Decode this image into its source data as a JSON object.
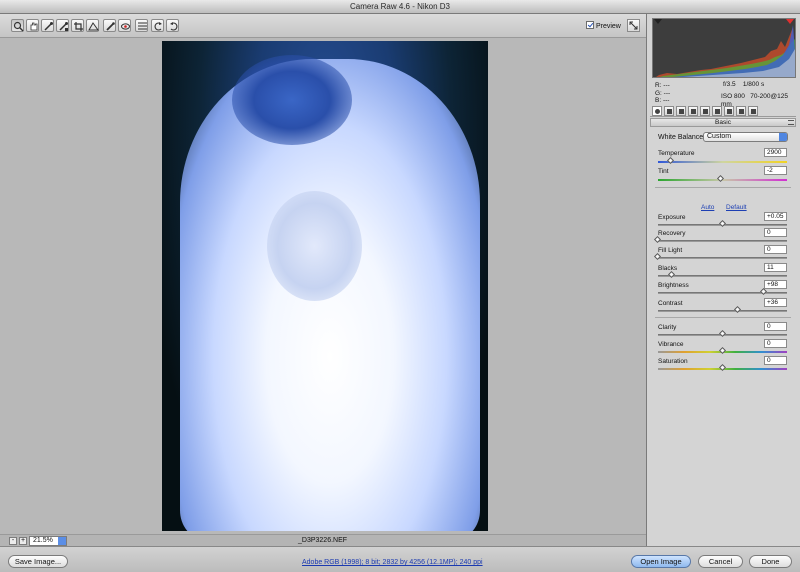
{
  "window": {
    "title": "Camera Raw 4.6  -  Nikon D3"
  },
  "toolbar": {
    "tools": [
      {
        "name": "zoom-tool"
      },
      {
        "name": "hand-tool"
      },
      {
        "name": "white-balance-tool"
      },
      {
        "name": "color-sampler-tool"
      },
      {
        "name": "crop-tool"
      },
      {
        "name": "straighten-tool"
      },
      {
        "name": "retouch-tool"
      },
      {
        "name": "red-eye-tool"
      },
      {
        "name": "preferences-tool"
      },
      {
        "name": "rotate-left-tool"
      },
      {
        "name": "rotate-right-tool"
      }
    ],
    "preview_label": "Preview",
    "preview_checked": true
  },
  "status": {
    "zoom": "21.5%",
    "filename": "_D3P3226.NEF"
  },
  "footer": {
    "save_label": "Save Image...",
    "workflow_link": "Adobe RGB (1998); 8 bit; 2832 by 4256 (12.1MP); 240 ppi",
    "open_label": "Open Image",
    "cancel_label": "Cancel",
    "done_label": "Done"
  },
  "info": {
    "r": "R:   ---",
    "g": "G:   ---",
    "b": "B:   ---",
    "aperture": "f/3.5",
    "shutter": "1/800 s",
    "iso": "ISO 800",
    "lens": "70-200@125 mm"
  },
  "panel": {
    "section_title": "Basic",
    "white_balance_label": "White Balance:",
    "white_balance_value": "Custom",
    "auto_label": "Auto",
    "default_label": "Default",
    "temperature": {
      "label": "Temperature",
      "value": "2900",
      "level": 0.1
    },
    "tint": {
      "label": "Tint",
      "value": "-2",
      "level": 0.49
    },
    "exposure": {
      "label": "Exposure",
      "value": "+0.05",
      "level": 0.5
    },
    "recovery": {
      "label": "Recovery",
      "value": "0",
      "level": 0.0
    },
    "fill_light": {
      "label": "Fill Light",
      "value": "0",
      "level": 0.0
    },
    "blacks": {
      "label": "Blacks",
      "value": "11",
      "level": 0.11
    },
    "brightness": {
      "label": "Brightness",
      "value": "+98",
      "level": 0.82
    },
    "contrast": {
      "label": "Contrast",
      "value": "+36",
      "level": 0.62
    },
    "clarity": {
      "label": "Clarity",
      "value": "0",
      "level": 0.5
    },
    "vibrance": {
      "label": "Vibrance",
      "value": "0",
      "level": 0.5
    },
    "saturation": {
      "label": "Saturation",
      "value": "0",
      "level": 0.5
    }
  },
  "colors": {
    "accent": "#4f86e1",
    "link": "#1b3ab1"
  }
}
